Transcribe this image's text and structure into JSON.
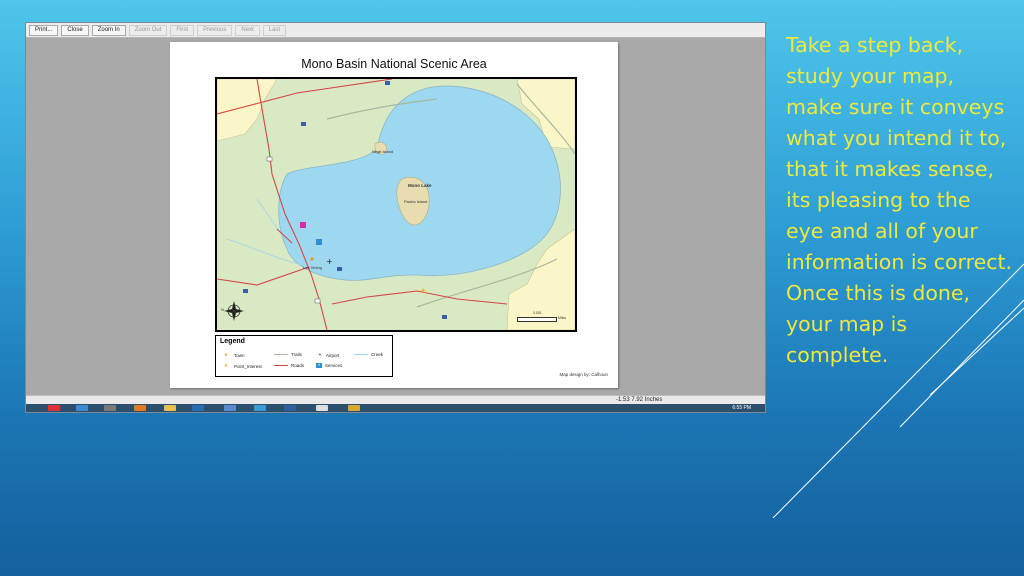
{
  "toolbar": {
    "buttons": [
      {
        "label": "Print...",
        "enabled": true
      },
      {
        "label": "Close",
        "enabled": true
      },
      {
        "label": "Zoom In",
        "enabled": true
      },
      {
        "label": "Zoom Out",
        "enabled": false
      },
      {
        "label": "First",
        "enabled": false
      },
      {
        "label": "Previous",
        "enabled": false
      },
      {
        "label": "Next",
        "enabled": false
      },
      {
        "label": "Last",
        "enabled": false
      }
    ]
  },
  "map": {
    "title": "Mono Basin National Scenic Area",
    "labels": {
      "lake": "Mono Lake",
      "island1": "Negit Island",
      "island2": "Paoha Island",
      "town": "Lee Vining",
      "north_arrow": "N",
      "scale": "0.001",
      "scale_unit": "Miles"
    },
    "legend": {
      "title": "Legend",
      "items": [
        {
          "label": "Town",
          "symbol": "dot",
          "color": "#e0a020"
        },
        {
          "label": "Trails",
          "symbol": "line",
          "color": "#a9b8a0"
        },
        {
          "label": "Airport",
          "symbol": "plus",
          "color": "#222222"
        },
        {
          "label": "Creek",
          "symbol": "line",
          "color": "#9fd3ef"
        },
        {
          "label": "Point_Interest",
          "symbol": "star",
          "color": "#f0b020"
        },
        {
          "label": "Roads",
          "symbol": "line",
          "color": "#d64545"
        },
        {
          "label": "Services",
          "symbol": "service-icon",
          "color": "#2f8fd0"
        }
      ]
    },
    "credit": "Map design by: Calhoun"
  },
  "statusbar": {
    "text": "-1.53  7.92 Inches"
  },
  "taskbar": {
    "clock": "6:55 PM"
  },
  "slide": {
    "body": "Take a step back, study your map, make sure it conveys what you intend it to, that it makes sense, its pleasing to the eye and all of your information is correct. Once this is done, your map is complete."
  },
  "colors": {
    "text_accent": "#f1e83a",
    "lake": "#9ed8f0",
    "land": "#d9e9c4",
    "private_land": "#fbf6c7"
  }
}
